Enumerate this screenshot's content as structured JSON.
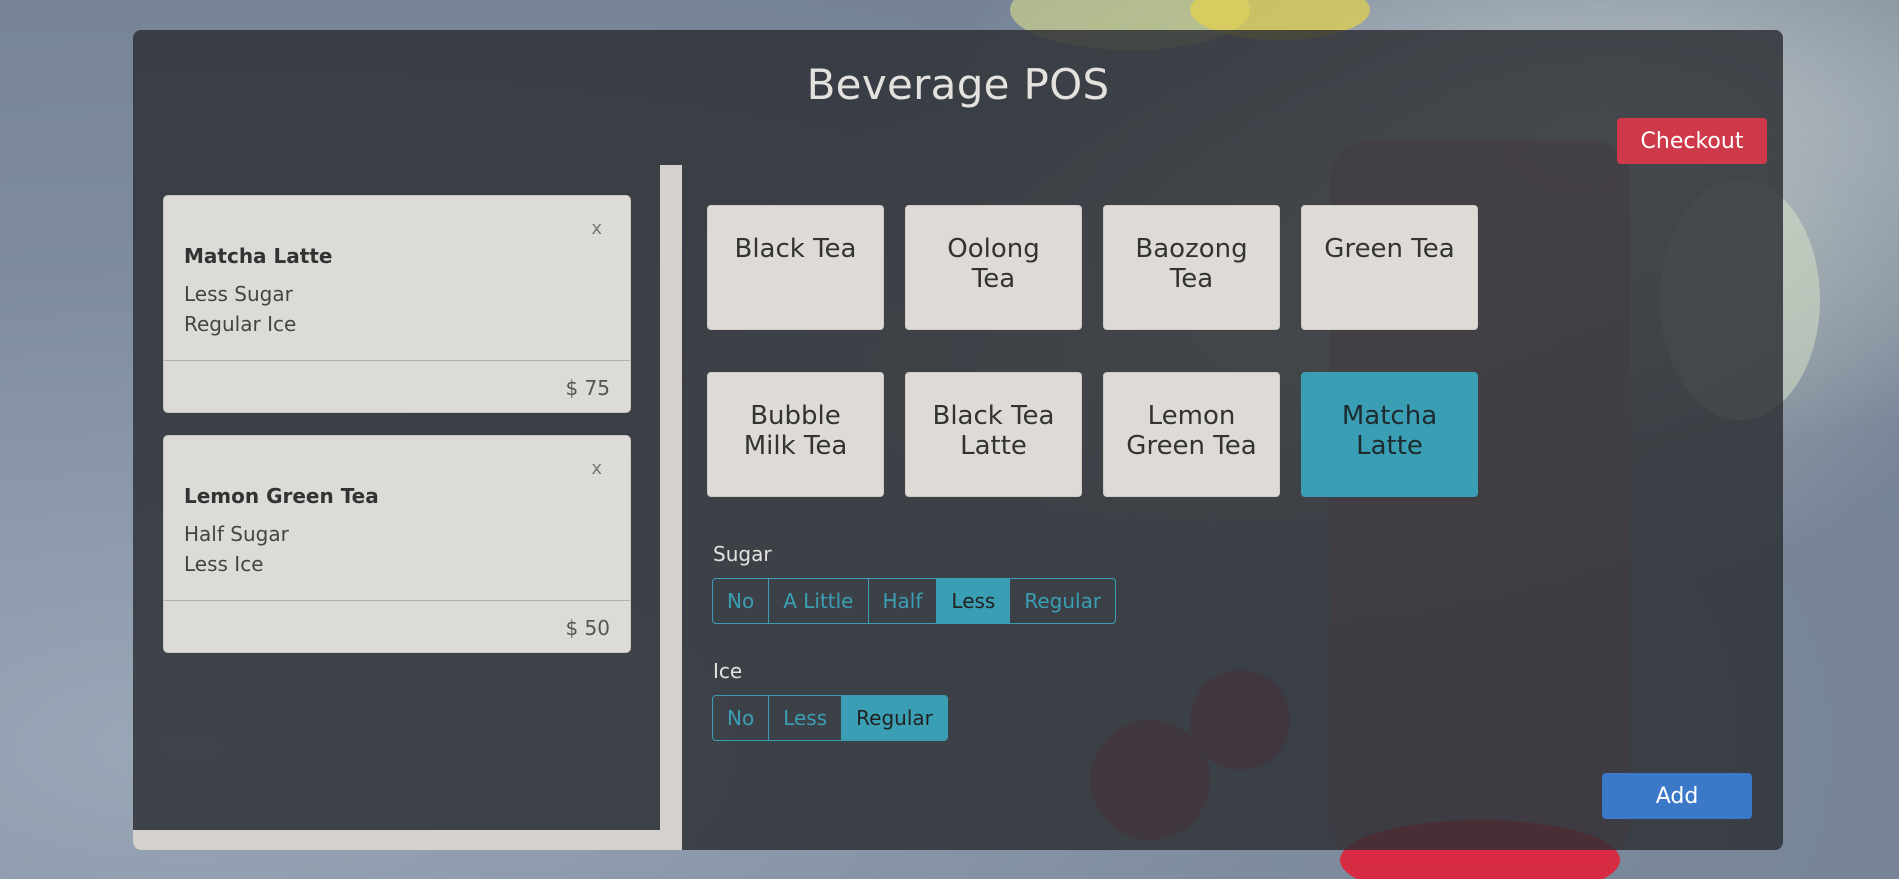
{
  "app": {
    "title": "Beverage POS",
    "checkout_label": "Checkout",
    "add_label": "Add"
  },
  "orders": [
    {
      "remove": "x",
      "name": "Matcha Latte",
      "sugar": "Less Sugar",
      "ice": "Regular Ice",
      "price": "$ 75"
    },
    {
      "remove": "x",
      "name": "Lemon Green Tea",
      "sugar": "Half Sugar",
      "ice": "Less Ice",
      "price": "$ 50"
    }
  ],
  "products": [
    {
      "line1": "Black Tea",
      "line2": "",
      "selected": false
    },
    {
      "line1": "Oolong",
      "line2": "Tea",
      "selected": false
    },
    {
      "line1": "Baozong",
      "line2": "Tea",
      "selected": false
    },
    {
      "line1": "Green Tea",
      "line2": "",
      "selected": false
    },
    {
      "line1": "Bubble",
      "line2": "Milk Tea",
      "selected": false
    },
    {
      "line1": "Black Tea",
      "line2": "Latte",
      "selected": false
    },
    {
      "line1": "Lemon",
      "line2": "Green Tea",
      "selected": false
    },
    {
      "line1": "Matcha",
      "line2": "Latte",
      "selected": true
    }
  ],
  "sugar": {
    "label": "Sugar",
    "options": [
      "No",
      "A Little",
      "Half",
      "Less",
      "Regular"
    ],
    "selected": "Less"
  },
  "ice": {
    "label": "Ice",
    "options": [
      "No",
      "Less",
      "Regular"
    ],
    "selected": "Regular"
  },
  "colors": {
    "accent": "#3a9fb4",
    "checkout": "#cf3a4a",
    "add": "#3b79c8",
    "card": "#dedbd6"
  }
}
